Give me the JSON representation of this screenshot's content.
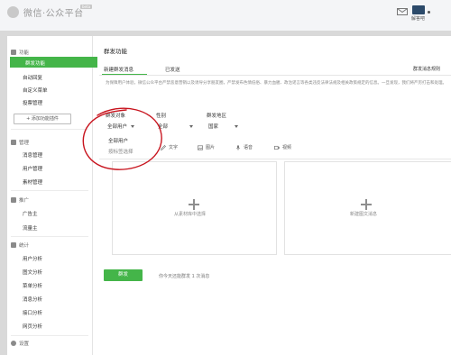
{
  "app": {
    "title": "微信·公众平台",
    "badge": "beta",
    "username": "解答吧"
  },
  "sidebar": {
    "func_section": "功能",
    "func_items": [
      "群发功能",
      "自动回复",
      "自定义菜单",
      "投票管理"
    ],
    "add_plugin": "+ 添加功能插件",
    "manage_section": "管理",
    "manage_items": [
      "消息管理",
      "用户管理",
      "素材管理"
    ],
    "promo_section": "推广",
    "promo_items": [
      "广告主",
      "流量主"
    ],
    "stats_section": "统计",
    "stats_items": [
      "用户分析",
      "图文分析",
      "菜单分析",
      "消息分析",
      "接口分析",
      "网页分析"
    ],
    "settings_section": "设置"
  },
  "main": {
    "title": "群发功能",
    "tabs": [
      "新建群发消息",
      "已发送"
    ],
    "tab_right": "群发消息规则",
    "notice": "为保障用户体验，微信公众平台严禁恶意营销以及诱导分享朋友圈，严禁发布色情低俗、暴力血腥、政治谣言等各类违反法律法规及相关政策规定的信息。一旦发现，我们将严厉打击和处理。",
    "filters": {
      "target_label": "群发对象",
      "target_value": "全部用户",
      "gender_label": "性别",
      "gender_value": "全部",
      "region_label": "群发地区",
      "region_value": "国家"
    },
    "dropdown": [
      "全部用户",
      "按标签选择"
    ],
    "toolbar": [
      "文字",
      "图片",
      "语音",
      "视频"
    ],
    "cards": [
      "从素材库中选择",
      "新建图文消息"
    ],
    "send_button": "群发",
    "send_info": "你今天还能群发 1 次消息"
  },
  "colors": {
    "accent": "#44b549",
    "annotation": "#c8141e"
  }
}
